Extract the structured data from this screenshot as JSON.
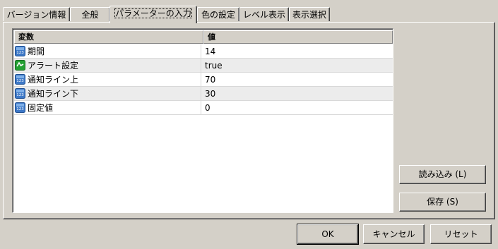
{
  "tabs": [
    {
      "label": "バージョン情報"
    },
    {
      "label": "全般"
    },
    {
      "label": "パラメーターの入力"
    },
    {
      "label": "色の設定"
    },
    {
      "label": "レベル表示"
    },
    {
      "label": "表示選択"
    }
  ],
  "grid": {
    "columns": [
      "変数",
      "値"
    ],
    "rows": [
      {
        "name": "期間",
        "value": "14",
        "icon": "integer-icon"
      },
      {
        "name": "アラート設定",
        "value": "true",
        "icon": "boolean-icon"
      },
      {
        "name": "通知ライン上",
        "value": "70",
        "icon": "integer-icon"
      },
      {
        "name": "通知ライン下",
        "value": "30",
        "icon": "integer-icon"
      },
      {
        "name": "固定値",
        "value": "0",
        "icon": "integer-icon"
      }
    ]
  },
  "side_buttons": {
    "load_label": "読み込み (L)",
    "save_label": "保存 (S)"
  },
  "dialog_buttons": {
    "ok_label": "OK",
    "cancel_label": "キャンセル",
    "reset_label": "リセット"
  },
  "icon_text": "123",
  "colors": {
    "background": "#d4d0c8",
    "integer_icon": "#3d78c7",
    "boolean_icon": "#23a033"
  }
}
